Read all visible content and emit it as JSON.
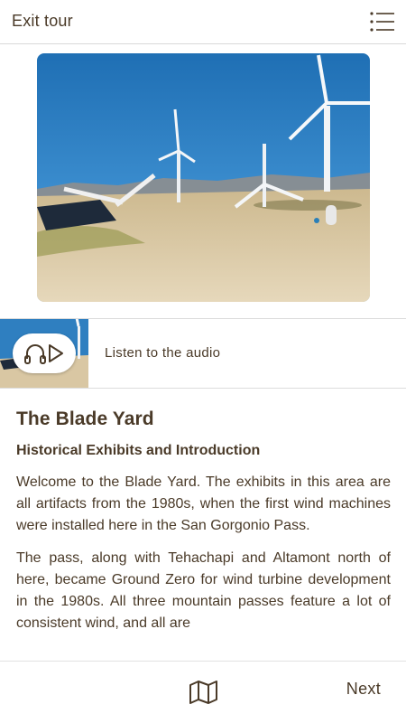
{
  "header": {
    "exit_label": "Exit tour",
    "menu_icon": "list-menu-icon"
  },
  "hero": {
    "image_subject": "wind turbines and blade artifacts in desert yard"
  },
  "audio": {
    "label": "Listen to the audio",
    "icons": [
      "headphones-icon",
      "play-icon"
    ]
  },
  "article": {
    "title": "The Blade Yard",
    "subtitle": "Historical Exhibits and Introduction",
    "paragraphs": [
      "Welcome to the Blade Yard. The exhibits in this area are all artifacts from the 1980s, when the first wind machines were installed here in the San Gorgonio Pass.",
      "The pass, along with Tehachapi and Altamont north of here, became Ground Zero for wind turbine development in the 1980s. All three mountain passes feature a lot of consistent wind, and all are"
    ]
  },
  "footer": {
    "map_icon": "map-icon",
    "next_label": "Next"
  },
  "colors": {
    "text": "#4a3a28",
    "divider": "#d9d9d9",
    "sky": "#2f7fc0",
    "ground": "#d9c7a3"
  }
}
